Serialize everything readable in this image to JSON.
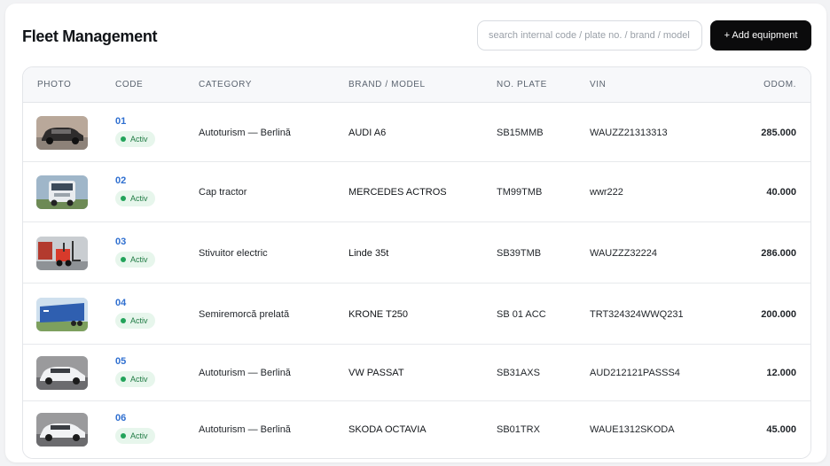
{
  "header": {
    "title": "Fleet Management",
    "search_placeholder": "search internal code / plate no. / brand / model",
    "add_button_label": "+ Add equipment"
  },
  "table": {
    "columns": [
      "PHOTO",
      "CODE",
      "CATEGORY",
      "BRAND / MODEL",
      "NO. PLATE",
      "VIN",
      "ODOM."
    ],
    "rows": [
      {
        "photo": "sedan-dark",
        "code": "01",
        "status": "Activ",
        "category": "Autoturism — Berlină",
        "brand_model": "AUDI A6",
        "plate": "SB15MMB",
        "vin": "WAUZZ21313313",
        "odometer": "285.000"
      },
      {
        "photo": "truck-tractor",
        "code": "02",
        "status": "Activ",
        "category": "Cap tractor",
        "brand_model": "MERCEDES ACTROS",
        "plate": "TM99TMB",
        "vin": "wwr222",
        "odometer": "40.000"
      },
      {
        "photo": "forklift",
        "code": "03",
        "status": "Activ",
        "category": "Stivuitor electric",
        "brand_model": "Linde 35t",
        "plate": "SB39TMB",
        "vin": "WAUZZZ32224",
        "odometer": "286.000"
      },
      {
        "photo": "semitrailer",
        "code": "04",
        "status": "Activ",
        "category": "Semiremorcă prelată",
        "brand_model": "KRONE T250",
        "plate": "SB 01 ACC",
        "vin": "TRT324324WWQ231",
        "odometer": "200.000"
      },
      {
        "photo": "sedan-white",
        "code": "05",
        "status": "Activ",
        "category": "Autoturism — Berlină",
        "brand_model": "VW PASSAT",
        "plate": "SB31AXS",
        "vin": "AUD212121PASSS4",
        "odometer": "12.000"
      },
      {
        "photo": "sedan-white",
        "code": "06",
        "status": "Activ",
        "category": "Autoturism — Berlină",
        "brand_model": "SKODA OCTAVIA",
        "plate": "SB01TRX",
        "vin": "WAUE1312SKODA",
        "odometer": "45.000"
      }
    ]
  },
  "colors": {
    "code_link": "#2f6fd0",
    "status_badge_bg": "#e7f6ec",
    "status_badge_text": "#1f7a43",
    "status_dot": "#22a35a",
    "primary_button": "#0b0b0c"
  }
}
